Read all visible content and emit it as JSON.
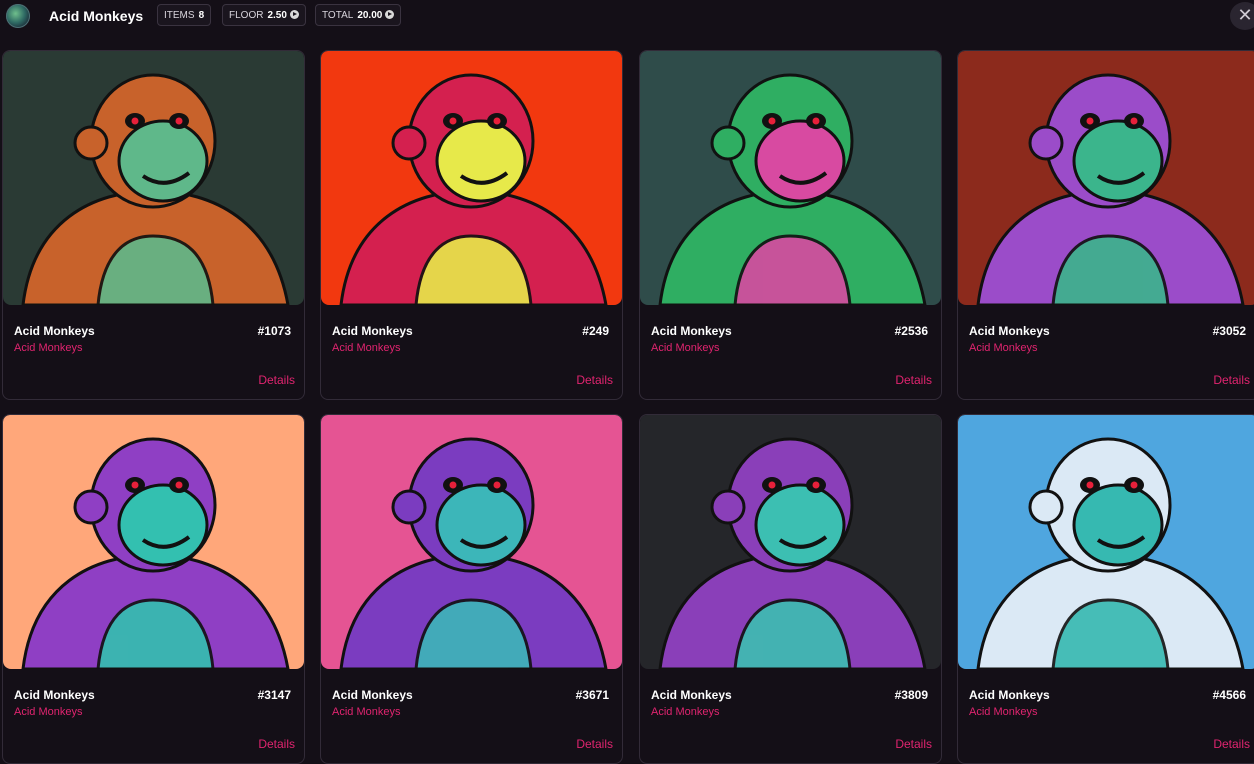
{
  "header": {
    "title": "Acid Monkeys",
    "items_label": "ITEMS",
    "items_value": "8",
    "floor_label": "FLOOR",
    "floor_value": "2.50",
    "total_label": "TOTAL",
    "total_value": "20.00",
    "close_label": "✕"
  },
  "cards": [
    {
      "name": "Acid Monkeys",
      "number": "#1073",
      "collection": "Acid Monkeys",
      "details": "Details",
      "bg": "#2a3a34",
      "accent": "#c8622b",
      "face": "#5fb88a"
    },
    {
      "name": "Acid Monkeys",
      "number": "#249",
      "collection": "Acid Monkeys",
      "details": "Details",
      "bg": "#f2380f",
      "accent": "#d4204f",
      "face": "#e7e94a"
    },
    {
      "name": "Acid Monkeys",
      "number": "#2536",
      "collection": "Acid Monkeys",
      "details": "Details",
      "bg": "#2f4c4a",
      "accent": "#2fae62",
      "face": "#d84aa1"
    },
    {
      "name": "Acid Monkeys",
      "number": "#3052",
      "collection": "Acid Monkeys",
      "details": "Details",
      "bg": "#8c2a1c",
      "accent": "#9b4cc9",
      "face": "#3bb58c"
    },
    {
      "name": "Acid Monkeys",
      "number": "#3147",
      "collection": "Acid Monkeys",
      "details": "Details",
      "bg": "#ffa77a",
      "accent": "#8f3fc4",
      "face": "#33c0b0"
    },
    {
      "name": "Acid Monkeys",
      "number": "#3671",
      "collection": "Acid Monkeys",
      "details": "Details",
      "bg": "#e55493",
      "accent": "#7b3cc0",
      "face": "#3cb6b9"
    },
    {
      "name": "Acid Monkeys",
      "number": "#3809",
      "collection": "Acid Monkeys",
      "details": "Details",
      "bg": "#25262a",
      "accent": "#8a3fb9",
      "face": "#3cbfb2"
    },
    {
      "name": "Acid Monkeys",
      "number": "#4566",
      "collection": "Acid Monkeys",
      "details": "Details",
      "bg": "#4fa6df",
      "accent": "#dbe9f5",
      "face": "#36b9b1"
    }
  ]
}
